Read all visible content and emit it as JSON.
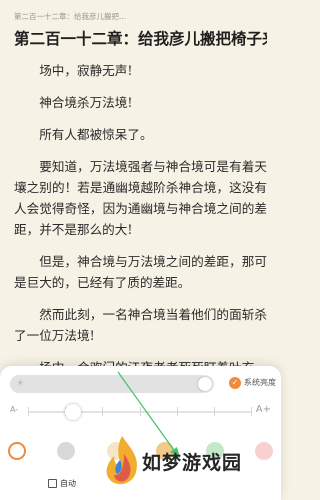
{
  "header": {
    "running_title": "第二百一十二章：给我彦儿搬把..."
  },
  "chapter": {
    "title": "第二百一十二章：给我彦儿搬把椅子来!",
    "paragraphs": [
      "场中，寂静无声!",
      "神合境杀万法境!",
      "所有人都被惊呆了。",
      "要知道，万法境强者与神合境可是有着天壤之别的！若是通幽境越阶杀神合境，这没有人会觉得奇怪，因为通幽境与神合境之间的差距，并不是那么的大!",
      "但是，神合境与万法境之间的差距，那可是巨大的，已经有了质的差距。",
      "然而此刻，一名神合境当着他们的面斩杀了一位万法境!",
      "场中，合欢门的江夜老者死死盯着叶玄，眼中已有凝重之色。"
    ]
  },
  "settings_panel": {
    "brightness_level": 0.97,
    "system_brightness_label": "系统亮度",
    "font_small_label": "A-",
    "font_large_label": "A+",
    "font_size_level": 0.15,
    "theme_colors": [
      "#ffffff",
      "#d9d9d9",
      "#f5e6c8",
      "#f0c98b",
      "#c4e8c8",
      "#f7d0d0"
    ],
    "auto_label": "自动"
  },
  "colors": {
    "accent": "#f08a3c",
    "page_bg": "#f7f2e6",
    "arrow": "#45c46a"
  },
  "watermark": {
    "text": "如梦游戏园"
  }
}
